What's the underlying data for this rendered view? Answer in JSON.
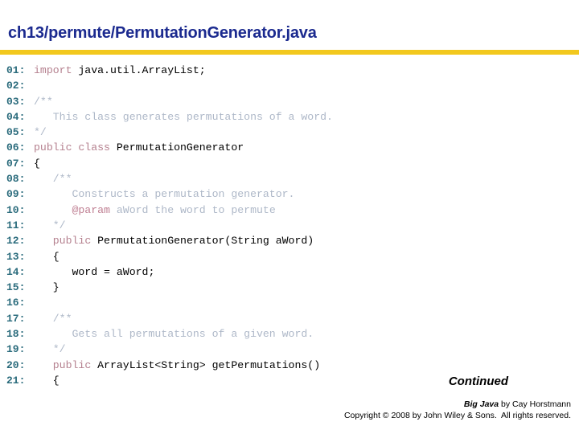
{
  "header": {
    "title": "ch13/permute/PermutationGenerator.java",
    "title_color": "#1b2a8f",
    "rule_color": "#f2c81e"
  },
  "code": {
    "language": "java",
    "line_number_color": "#2a6b7c",
    "keyword_color": "#b5818f",
    "comment_color": "#aeb8c8",
    "text_color": "#000000",
    "lines": [
      {
        "no": "01:",
        "tokens": [
          {
            "t": "import",
            "c": "kw"
          },
          {
            "t": " java.util.ArrayList;",
            "c": "txt"
          }
        ]
      },
      {
        "no": "02:",
        "tokens": [
          {
            "t": "",
            "c": "txt"
          }
        ]
      },
      {
        "no": "03:",
        "tokens": [
          {
            "t": "/**",
            "c": "cmt"
          }
        ]
      },
      {
        "no": "04:",
        "tokens": [
          {
            "t": "   This class generates permutations of a word.",
            "c": "cmt"
          }
        ]
      },
      {
        "no": "05:",
        "tokens": [
          {
            "t": "*/",
            "c": "cmt"
          }
        ]
      },
      {
        "no": "06:",
        "tokens": [
          {
            "t": "public class",
            "c": "kw"
          },
          {
            "t": " PermutationGenerator",
            "c": "txt"
          }
        ]
      },
      {
        "no": "07:",
        "tokens": [
          {
            "t": "{",
            "c": "txt"
          }
        ]
      },
      {
        "no": "08:",
        "tokens": [
          {
            "t": "   /**",
            "c": "cmt"
          }
        ]
      },
      {
        "no": "09:",
        "tokens": [
          {
            "t": "      Constructs a permutation generator.",
            "c": "cmt"
          }
        ]
      },
      {
        "no": "10:",
        "tokens": [
          {
            "t": "      ",
            "c": "cmt"
          },
          {
            "t": "@param",
            "c": "tag"
          },
          {
            "t": " aWord the word to permute",
            "c": "cmt"
          }
        ]
      },
      {
        "no": "11:",
        "tokens": [
          {
            "t": "   */",
            "c": "cmt"
          }
        ]
      },
      {
        "no": "12:",
        "tokens": [
          {
            "t": "   ",
            "c": "txt"
          },
          {
            "t": "public",
            "c": "kw"
          },
          {
            "t": " PermutationGenerator(String aWord)",
            "c": "txt"
          }
        ]
      },
      {
        "no": "13:",
        "tokens": [
          {
            "t": "   {",
            "c": "txt"
          }
        ]
      },
      {
        "no": "14:",
        "tokens": [
          {
            "t": "      word = aWord;",
            "c": "txt"
          }
        ]
      },
      {
        "no": "15:",
        "tokens": [
          {
            "t": "   }",
            "c": "txt"
          }
        ]
      },
      {
        "no": "16:",
        "tokens": [
          {
            "t": "",
            "c": "txt"
          }
        ]
      },
      {
        "no": "17:",
        "tokens": [
          {
            "t": "   /**",
            "c": "cmt"
          }
        ]
      },
      {
        "no": "18:",
        "tokens": [
          {
            "t": "      Gets all permutations of a given word.",
            "c": "cmt"
          }
        ]
      },
      {
        "no": "19:",
        "tokens": [
          {
            "t": "   */",
            "c": "cmt"
          }
        ]
      },
      {
        "no": "20:",
        "tokens": [
          {
            "t": "   ",
            "c": "txt"
          },
          {
            "t": "public",
            "c": "kw"
          },
          {
            "t": " ArrayList<String> getPermutations()",
            "c": "txt"
          }
        ]
      },
      {
        "no": "21:",
        "tokens": [
          {
            "t": "   {",
            "c": "txt"
          }
        ]
      }
    ]
  },
  "continued": {
    "label": "Continued"
  },
  "footer": {
    "book_title": "Big Java",
    "byline": " by Cay Horstmann",
    "copyright": "Copyright © 2008 by John Wiley & Sons.  All rights reserved."
  }
}
